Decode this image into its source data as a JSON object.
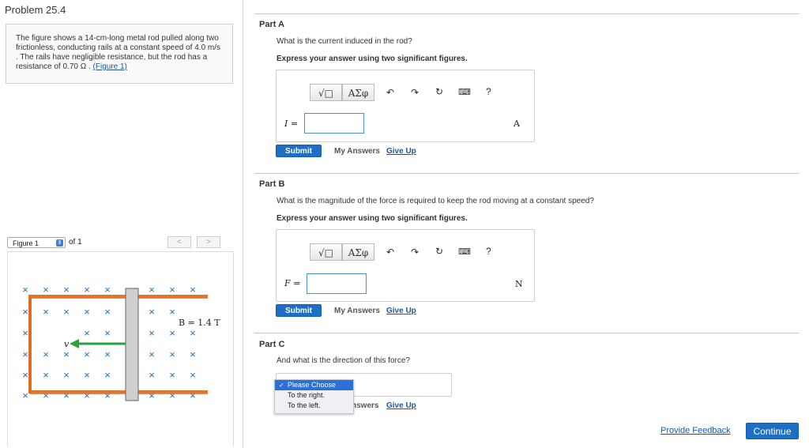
{
  "problem": {
    "title": "Problem 25.4",
    "text_before": "The figure shows a 14-cm-long metal rod pulled along two frictionless, conducting rails at a constant speed of 4.0 m/s . The rails have negligible resistance, but the rod has a resistance of 0.70 Ω .",
    "figure_link": "(Figure 1)"
  },
  "figure": {
    "select_value": "Figure 1",
    "of_label": "of 1",
    "prev": "<",
    "next": ">",
    "b_label": "B = 1.4 T",
    "v_label": "v",
    "x_mark": "×"
  },
  "toolbar": {
    "templates_label": "√□",
    "symbols_label": "ΑΣφ",
    "undo_icon": "undo-icon",
    "redo_icon": "redo-icon",
    "reset_icon": "reset-icon",
    "keyboard_icon": "keyboard-icon",
    "help_label": "?"
  },
  "partA": {
    "label": "Part A",
    "question": "What is the current induced in the rod?",
    "instruction": "Express your answer using two significant figures.",
    "var_label": "I =",
    "input_value": "",
    "unit": "A",
    "submit": "Submit",
    "my_answers": "My Answers",
    "give_up": "Give Up"
  },
  "partB": {
    "label": "Part B",
    "question": "What is the magnitude of the force is required to keep the rod moving at a constant speed?",
    "instruction": "Express your answer using two significant figures.",
    "var_label": "F =",
    "input_value": "",
    "unit": "N",
    "submit": "Submit",
    "my_answers": "My Answers",
    "give_up": "Give Up"
  },
  "partC": {
    "label": "Part C",
    "question": "And what is the direction of this force?",
    "options": [
      "Please Choose",
      "To the right.",
      "To the left."
    ],
    "my_answers_partial": "nswers",
    "give_up": "Give Up"
  },
  "footer": {
    "feedback": "Provide Feedback",
    "continue": "Continue"
  },
  "colors": {
    "primary_button": "#1c6fc4",
    "link": "#1a57a3",
    "rail": "#e8742a",
    "rod": "#c8c8c8",
    "arrow": "#2aa23a",
    "x_mark": "#1f6fbf"
  }
}
